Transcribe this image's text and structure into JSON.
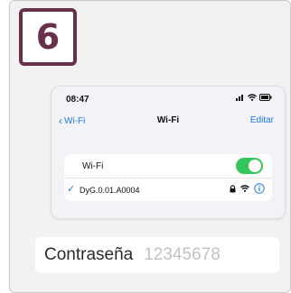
{
  "step": {
    "number": "6"
  },
  "phone": {
    "status_time": "08:47",
    "nav": {
      "back_label": "Wi-Fi",
      "title": "Wi-Fi",
      "edit_label": "Editar"
    },
    "wifi_toggle": {
      "label": "Wi-Fi",
      "on": true
    },
    "network": {
      "name": "DyG.0.01.A0004",
      "selected": true,
      "locked": true
    },
    "colors": {
      "accent": "#1e7ae6",
      "toggle_on": "#34c759"
    }
  },
  "password_field": {
    "label": "Contraseña",
    "value": "12345678"
  },
  "colors": {
    "step_badge": "#6a2f4b"
  },
  "icons": [
    "chevron-left-icon",
    "signal-icon",
    "wifi-icon",
    "battery-icon",
    "checkmark-icon",
    "lock-icon",
    "info-icon"
  ]
}
